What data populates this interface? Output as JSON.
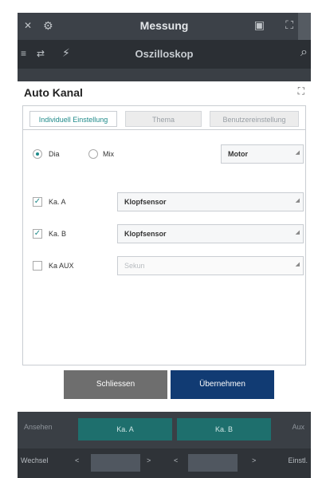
{
  "statusbar": {
    "left_icon": "✕",
    "left_icon2": "⚙",
    "title": "Messung",
    "right_icon": "▣",
    "right_icon2": "⛶"
  },
  "toolbar": {
    "t1": "≡",
    "t2": "⇄",
    "t3": "⚡",
    "title": "Oszilloskop",
    "search_icon": "⌕"
  },
  "dialog": {
    "title": "Auto Kanal",
    "expand_icon": "⛶",
    "tabs": [
      "Individuell Einstellung",
      "Thema",
      "Benutzereinstellung"
    ],
    "mode": {
      "option1": "Dia",
      "option2": "Mix",
      "selected": "Dia",
      "dropdown": "Motor"
    },
    "channels": [
      {
        "label": "Ka. A",
        "checked": true,
        "value": "Klopfsensor"
      },
      {
        "label": "Ka. B",
        "checked": true,
        "value": "Klopfsensor"
      },
      {
        "label": "Ka AUX",
        "checked": false,
        "value": "Sekun"
      }
    ],
    "buttons": {
      "close": "Schliessen",
      "apply": "Übernehmen"
    }
  },
  "bottom": {
    "left": "Ansehen",
    "ch_a": "Ka. A",
    "ch_b": "Ka. B",
    "right": "Aux",
    "r2_left": "Wechsel",
    "r2_prev": "<",
    "r2_next": ">",
    "r2_prev2": "<",
    "r2_next2": ">",
    "r2_right": "Einstl."
  }
}
